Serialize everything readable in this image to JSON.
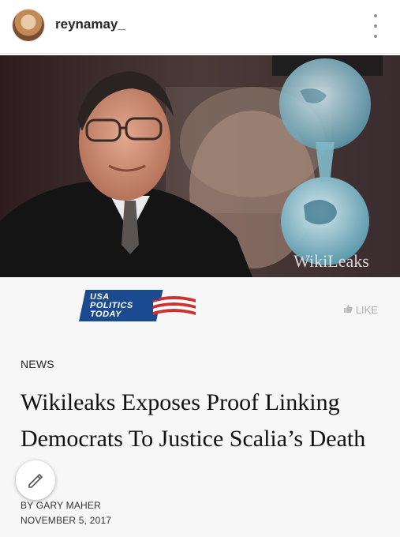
{
  "post": {
    "username": "reynamay_",
    "image_watermark": "WikiLeaks"
  },
  "article": {
    "brand_logo": [
      "USA",
      "POLITICS",
      "TODAY"
    ],
    "like_label": "LIKE",
    "category": "NEWS",
    "headline": "Wikileaks Exposes Proof Linking Democrats To Justice Scalia’s Death",
    "author": "BY GARY MAHER",
    "date": "NOVEMBER 5, 2017"
  },
  "icons": {
    "more": "more-vertical-icon",
    "like": "thumbs-up-icon",
    "edit": "pencil-icon"
  },
  "colors": {
    "brand_blue": "#1a4a8f",
    "brand_red": "#d32f2f"
  }
}
